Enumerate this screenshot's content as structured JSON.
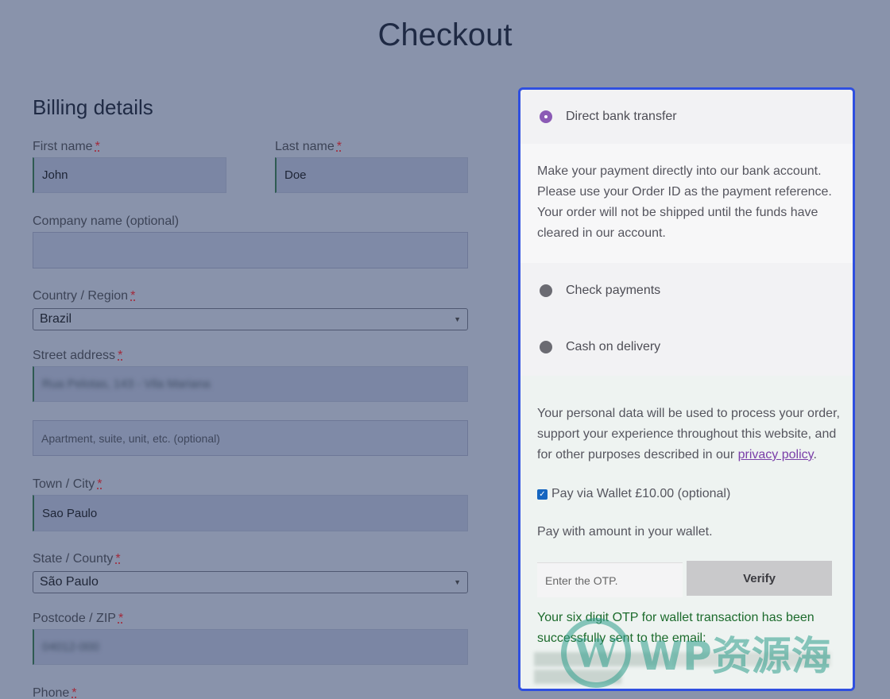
{
  "page": {
    "title": "Checkout"
  },
  "billing": {
    "title": "Billing details",
    "first_name": {
      "label": "First name",
      "value": "John"
    },
    "last_name": {
      "label": "Last name",
      "value": "Doe"
    },
    "company": {
      "label": "Company name (optional)",
      "value": ""
    },
    "country": {
      "label": "Country / Region",
      "value": "Brazil"
    },
    "street": {
      "label": "Street address",
      "value": "Rua Pelotas, 143 - Vila Mariana",
      "placeholder2": "Apartment, suite, unit, etc. (optional)"
    },
    "city": {
      "label": "Town / City",
      "value": "Sao Paulo"
    },
    "state": {
      "label": "State / County",
      "value": "São Paulo"
    },
    "postcode": {
      "label": "Postcode / ZIP",
      "value": "04012-000"
    },
    "phone": {
      "label": "Phone"
    },
    "required_mark": "*"
  },
  "payment": {
    "methods": [
      {
        "label": "Direct bank transfer",
        "selected": true
      },
      {
        "label": "Check payments",
        "selected": false
      },
      {
        "label": "Cash on delivery",
        "selected": false
      }
    ],
    "bank_desc": "Make your payment directly into our bank account. Please use your Order ID as the payment reference. Your order will not be shipped until the funds have cleared in our account.",
    "privacy_text": "Your personal data will be used to process your order, support your experience throughout this website, and for other purposes described in our",
    "privacy_link": "privacy policy",
    "wallet_label": "Pay via Wallet £10.00 (optional)",
    "wallet_note": "Pay with amount in your wallet.",
    "otp_placeholder": "Enter the OTP.",
    "verify_label": "Verify",
    "otp_message": "Your six digit OTP for wallet transaction has been successfully sent to the email:"
  },
  "watermark": {
    "text": "WP资源海",
    "logo_letter": "W"
  },
  "colors": {
    "panel_border": "#2f4fe0",
    "radio_selected": "#8b5ab5",
    "otp_message": "#1c6b2c"
  }
}
